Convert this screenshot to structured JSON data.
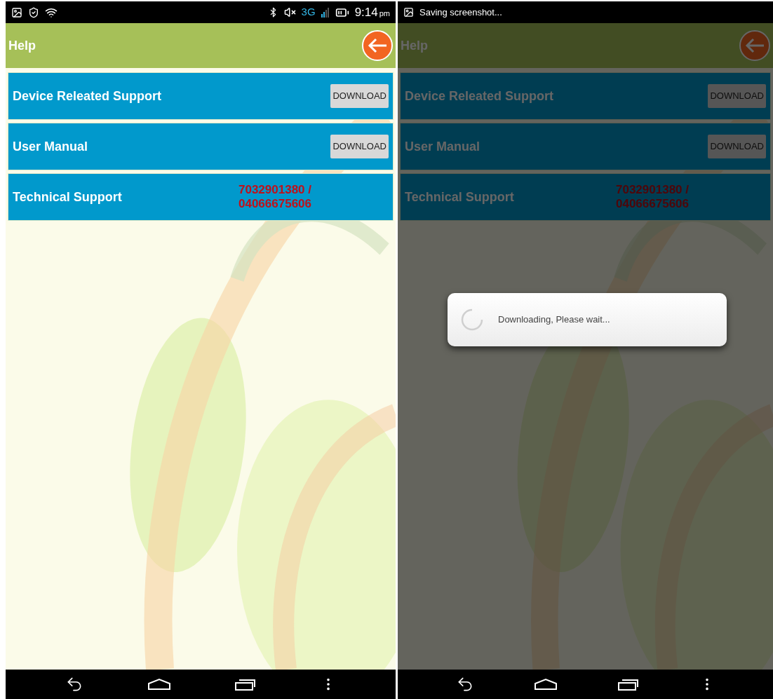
{
  "screens": [
    {
      "dimmed": false,
      "status_bar": {
        "kind": "icons",
        "network": "3G",
        "time": "9:14",
        "time_suffix": "pm"
      },
      "title": "Help",
      "sections": [
        {
          "kind": "download",
          "label": "Device Releated Support",
          "button": "DOWNLOAD"
        },
        {
          "kind": "download",
          "label": "User Manual",
          "button": "DOWNLOAD"
        },
        {
          "kind": "phone",
          "label": "Technical Support",
          "phone": "7032901380 / 04066675606"
        }
      ]
    },
    {
      "dimmed": true,
      "status_bar": {
        "kind": "notification",
        "text": "Saving screenshot..."
      },
      "title": "Help",
      "sections": [
        {
          "kind": "download",
          "label": "Device Releated Support",
          "button": "DOWNLOAD"
        },
        {
          "kind": "download",
          "label": "User Manual",
          "button": "DOWNLOAD"
        },
        {
          "kind": "phone",
          "label": "Technical Support",
          "phone": "7032901380 / 04066675606"
        }
      ],
      "dialog": {
        "message": "Downloading, Please wait..."
      }
    }
  ]
}
